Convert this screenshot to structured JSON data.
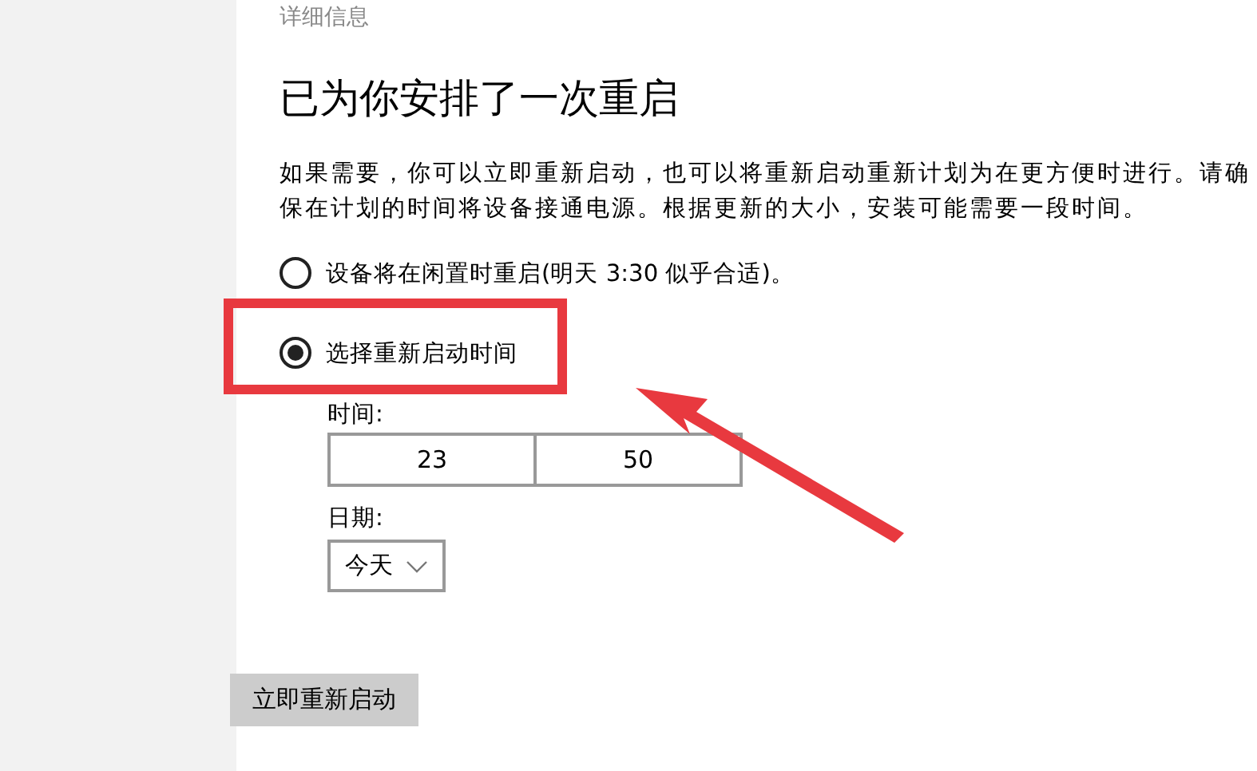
{
  "breadcrumb": "详细信息",
  "heading": "已为你安排了一次重启",
  "description": "如果需要，你可以立即重新启动，也可以将重新启动重新计划为在更方便时进行。请确保在计划的时间将设备接通电源。根据更新的大小，安装可能需要一段时间。",
  "options": [
    {
      "label": "设备将在闲置时重启(明天 3:30 似乎合适)。",
      "selected": false,
      "highlighted": false
    },
    {
      "label": "选择重新启动时间",
      "selected": true,
      "highlighted": true
    }
  ],
  "time": {
    "label": "时间:",
    "hour": "23",
    "minute": "50"
  },
  "date": {
    "label": "日期:",
    "value": "今天"
  },
  "restart_button": "立即重新启动"
}
